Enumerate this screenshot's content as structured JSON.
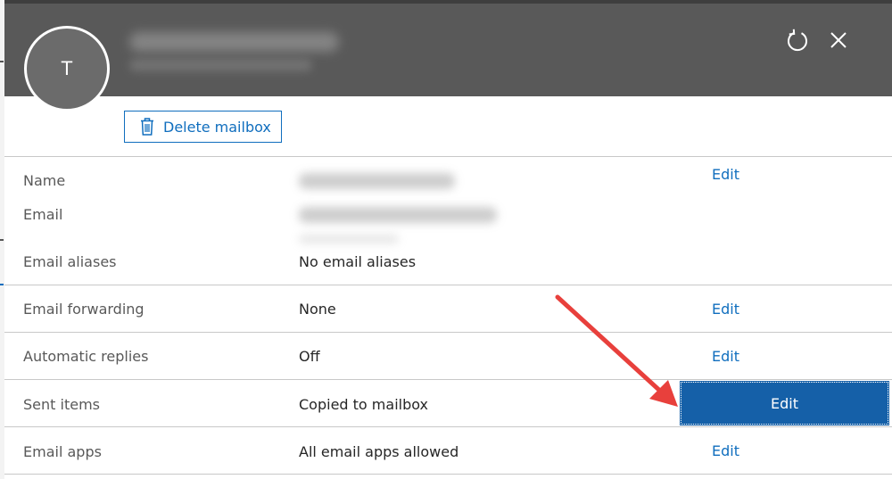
{
  "window": {
    "avatar_initial": "T",
    "colors": {
      "header": "#595959",
      "accent": "#106ebe",
      "highlight": "#1560a8",
      "annotation_arrow": "#e8403c"
    }
  },
  "toolbar": {
    "delete_label": "Delete mailbox",
    "delete_icon": "trash-icon",
    "refresh_icon": "refresh-icon",
    "close_icon": "close-icon"
  },
  "details": {
    "name": {
      "label": "Name",
      "action": "Edit"
    },
    "email": {
      "label": "Email"
    },
    "aliases": {
      "label": "Email aliases",
      "value": "No email aliases"
    },
    "forwarding": {
      "label": "Email forwarding",
      "value": "None",
      "action": "Edit"
    },
    "auto_replies": {
      "label": "Automatic replies",
      "value": "Off",
      "action": "Edit"
    },
    "sent_items": {
      "label": "Sent items",
      "value": "Copied to mailbox",
      "action": "Edit"
    },
    "email_apps": {
      "label": "Email apps",
      "value": "All email apps allowed",
      "action": "Edit"
    }
  }
}
